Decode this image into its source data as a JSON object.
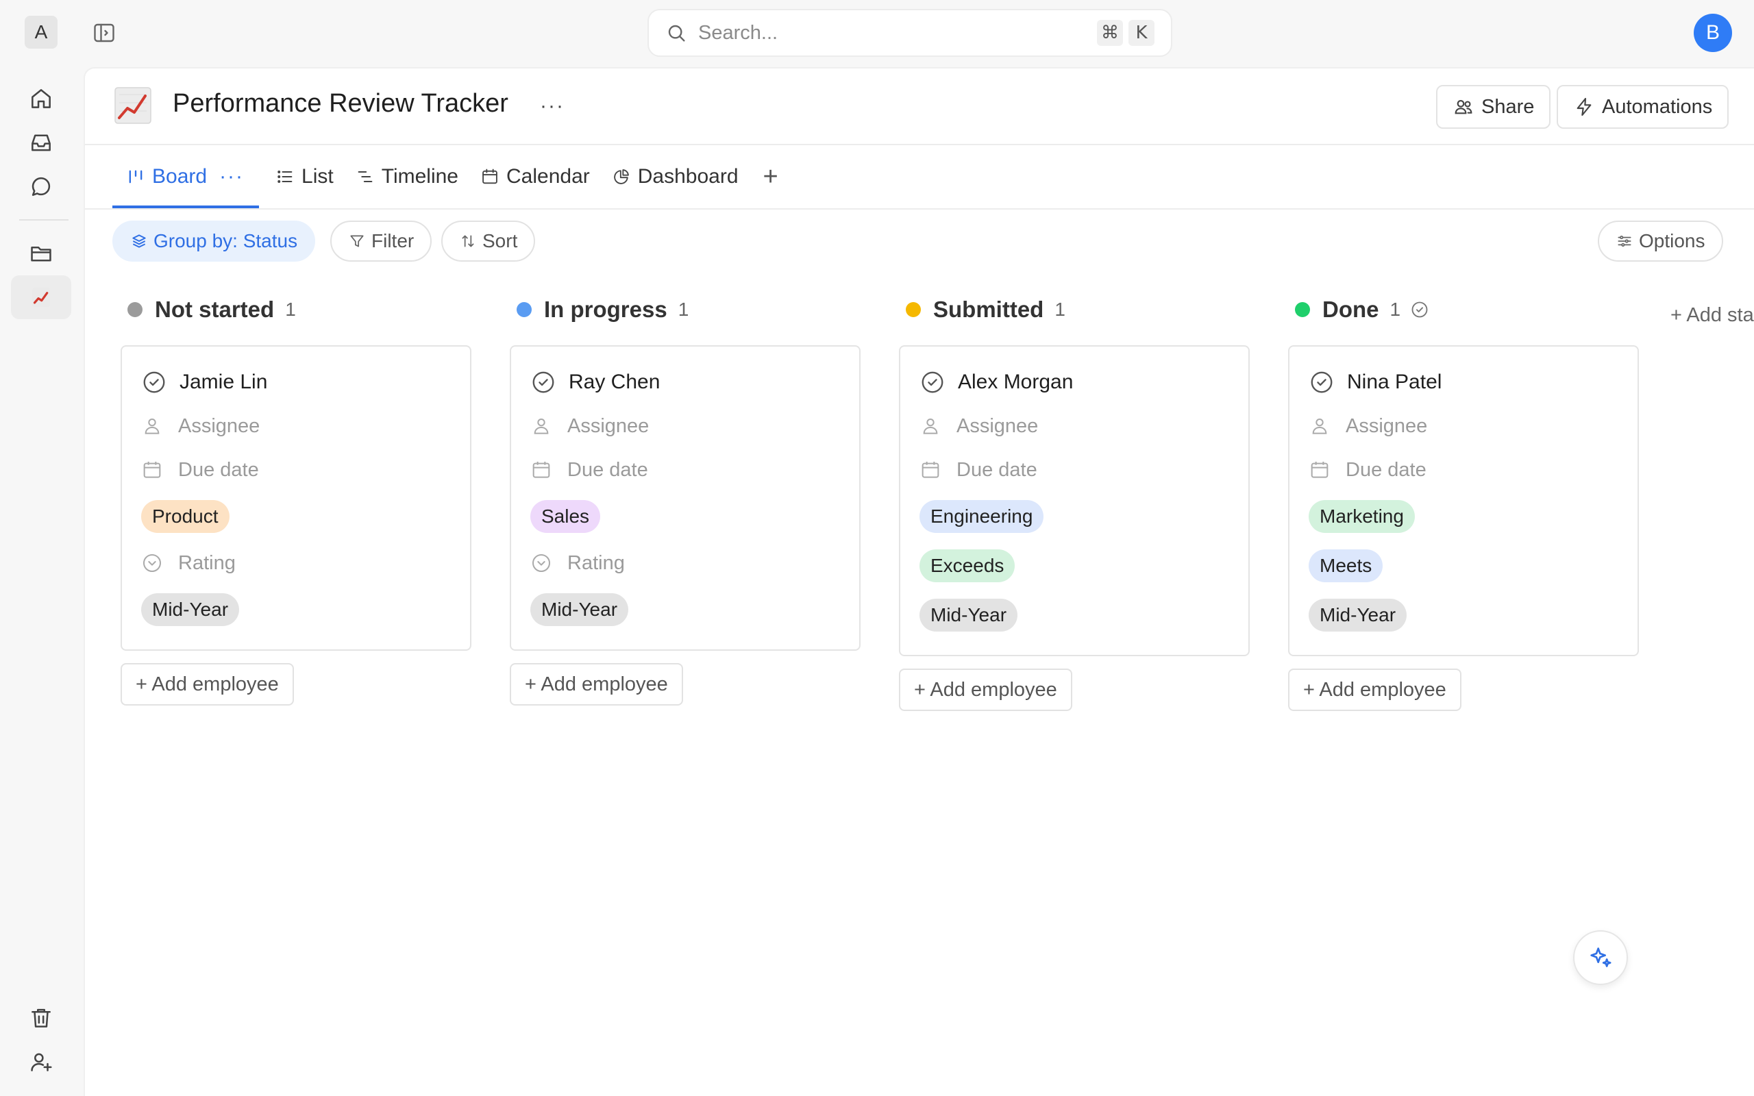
{
  "workspace": {
    "initial": "A"
  },
  "search": {
    "placeholder": "Search...",
    "shortcut_mod": "⌘",
    "shortcut_key": "K"
  },
  "user": {
    "initial": "B"
  },
  "rail": {
    "page_emoji": "📈"
  },
  "page": {
    "emoji": "📈",
    "title": "Performance Review Tracker",
    "more": "···",
    "share_label": "Share",
    "automations_label": "Automations"
  },
  "tabs": [
    {
      "label": "Board",
      "active": true,
      "more": "···"
    },
    {
      "label": "List"
    },
    {
      "label": "Timeline"
    },
    {
      "label": "Calendar"
    },
    {
      "label": "Dashboard"
    }
  ],
  "toolbar": {
    "group_label": "Group by: Status",
    "filter_label": "Filter",
    "sort_label": "Sort",
    "options_label": "Options"
  },
  "columns": [
    {
      "title": "Not started",
      "count": "1",
      "color": "#9b9b9b",
      "card": {
        "name": "Jamie Lin",
        "assignee": "Assignee",
        "due": "Due date",
        "department": {
          "label": "Product",
          "color": "#fde2c4"
        },
        "rating_placeholder": "Rating",
        "cycle": {
          "label": "Mid-Year",
          "color": "#e3e3e3"
        }
      },
      "add_label": "+ Add employee"
    },
    {
      "title": "In progress",
      "count": "1",
      "color": "#5a9cf2",
      "card": {
        "name": "Ray Chen",
        "assignee": "Assignee",
        "due": "Due date",
        "department": {
          "label": "Sales",
          "color": "#eed9fb"
        },
        "rating_placeholder": "Rating",
        "cycle": {
          "label": "Mid-Year",
          "color": "#e3e3e3"
        }
      },
      "add_label": "+ Add employee"
    },
    {
      "title": "Submitted",
      "count": "1",
      "color": "#f5b800",
      "card": {
        "name": "Alex Morgan",
        "assignee": "Assignee",
        "due": "Due date",
        "department": {
          "label": "Engineering",
          "color": "#dce7fc"
        },
        "rating": {
          "label": "Exceeds",
          "color": "#d3f2dd"
        },
        "cycle": {
          "label": "Mid-Year",
          "color": "#e3e3e3"
        }
      },
      "add_label": "+ Add employee"
    },
    {
      "title": "Done",
      "count": "1",
      "color": "#1fcf6b",
      "card": {
        "name": "Nina Patel",
        "assignee": "Assignee",
        "due": "Due date",
        "department": {
          "label": "Marketing",
          "color": "#d3f2dd"
        },
        "rating": {
          "label": "Meets",
          "color": "#dce7fc"
        },
        "cycle": {
          "label": "Mid-Year",
          "color": "#e3e3e3"
        }
      },
      "add_label": "+ Add employee"
    }
  ],
  "add_status_label": "+ Add status"
}
